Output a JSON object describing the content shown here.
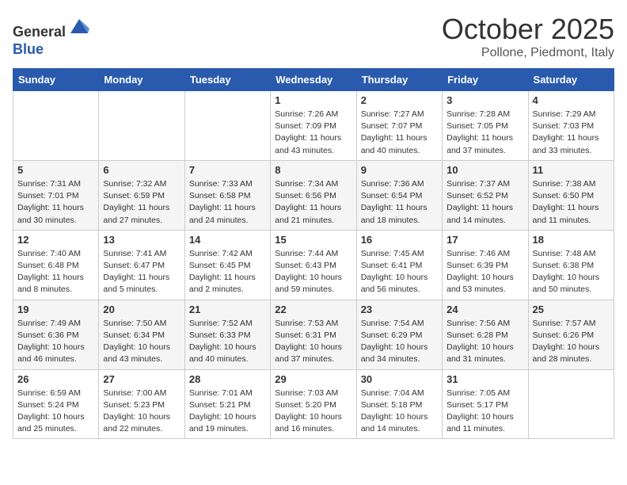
{
  "header": {
    "logo_line1": "General",
    "logo_line2": "Blue",
    "month": "October 2025",
    "location": "Pollone, Piedmont, Italy"
  },
  "days_of_week": [
    "Sunday",
    "Monday",
    "Tuesday",
    "Wednesday",
    "Thursday",
    "Friday",
    "Saturday"
  ],
  "weeks": [
    [
      {
        "day": "",
        "info": ""
      },
      {
        "day": "",
        "info": ""
      },
      {
        "day": "",
        "info": ""
      },
      {
        "day": "1",
        "info": "Sunrise: 7:26 AM\nSunset: 7:09 PM\nDaylight: 11 hours\nand 43 minutes."
      },
      {
        "day": "2",
        "info": "Sunrise: 7:27 AM\nSunset: 7:07 PM\nDaylight: 11 hours\nand 40 minutes."
      },
      {
        "day": "3",
        "info": "Sunrise: 7:28 AM\nSunset: 7:05 PM\nDaylight: 11 hours\nand 37 minutes."
      },
      {
        "day": "4",
        "info": "Sunrise: 7:29 AM\nSunset: 7:03 PM\nDaylight: 11 hours\nand 33 minutes."
      }
    ],
    [
      {
        "day": "5",
        "info": "Sunrise: 7:31 AM\nSunset: 7:01 PM\nDaylight: 11 hours\nand 30 minutes."
      },
      {
        "day": "6",
        "info": "Sunrise: 7:32 AM\nSunset: 6:59 PM\nDaylight: 11 hours\nand 27 minutes."
      },
      {
        "day": "7",
        "info": "Sunrise: 7:33 AM\nSunset: 6:58 PM\nDaylight: 11 hours\nand 24 minutes."
      },
      {
        "day": "8",
        "info": "Sunrise: 7:34 AM\nSunset: 6:56 PM\nDaylight: 11 hours\nand 21 minutes."
      },
      {
        "day": "9",
        "info": "Sunrise: 7:36 AM\nSunset: 6:54 PM\nDaylight: 11 hours\nand 18 minutes."
      },
      {
        "day": "10",
        "info": "Sunrise: 7:37 AM\nSunset: 6:52 PM\nDaylight: 11 hours\nand 14 minutes."
      },
      {
        "day": "11",
        "info": "Sunrise: 7:38 AM\nSunset: 6:50 PM\nDaylight: 11 hours\nand 11 minutes."
      }
    ],
    [
      {
        "day": "12",
        "info": "Sunrise: 7:40 AM\nSunset: 6:48 PM\nDaylight: 11 hours\nand 8 minutes."
      },
      {
        "day": "13",
        "info": "Sunrise: 7:41 AM\nSunset: 6:47 PM\nDaylight: 11 hours\nand 5 minutes."
      },
      {
        "day": "14",
        "info": "Sunrise: 7:42 AM\nSunset: 6:45 PM\nDaylight: 11 hours\nand 2 minutes."
      },
      {
        "day": "15",
        "info": "Sunrise: 7:44 AM\nSunset: 6:43 PM\nDaylight: 10 hours\nand 59 minutes."
      },
      {
        "day": "16",
        "info": "Sunrise: 7:45 AM\nSunset: 6:41 PM\nDaylight: 10 hours\nand 56 minutes."
      },
      {
        "day": "17",
        "info": "Sunrise: 7:46 AM\nSunset: 6:39 PM\nDaylight: 10 hours\nand 53 minutes."
      },
      {
        "day": "18",
        "info": "Sunrise: 7:48 AM\nSunset: 6:38 PM\nDaylight: 10 hours\nand 50 minutes."
      }
    ],
    [
      {
        "day": "19",
        "info": "Sunrise: 7:49 AM\nSunset: 6:36 PM\nDaylight: 10 hours\nand 46 minutes."
      },
      {
        "day": "20",
        "info": "Sunrise: 7:50 AM\nSunset: 6:34 PM\nDaylight: 10 hours\nand 43 minutes."
      },
      {
        "day": "21",
        "info": "Sunrise: 7:52 AM\nSunset: 6:33 PM\nDaylight: 10 hours\nand 40 minutes."
      },
      {
        "day": "22",
        "info": "Sunrise: 7:53 AM\nSunset: 6:31 PM\nDaylight: 10 hours\nand 37 minutes."
      },
      {
        "day": "23",
        "info": "Sunrise: 7:54 AM\nSunset: 6:29 PM\nDaylight: 10 hours\nand 34 minutes."
      },
      {
        "day": "24",
        "info": "Sunrise: 7:56 AM\nSunset: 6:28 PM\nDaylight: 10 hours\nand 31 minutes."
      },
      {
        "day": "25",
        "info": "Sunrise: 7:57 AM\nSunset: 6:26 PM\nDaylight: 10 hours\nand 28 minutes."
      }
    ],
    [
      {
        "day": "26",
        "info": "Sunrise: 6:59 AM\nSunset: 5:24 PM\nDaylight: 10 hours\nand 25 minutes."
      },
      {
        "day": "27",
        "info": "Sunrise: 7:00 AM\nSunset: 5:23 PM\nDaylight: 10 hours\nand 22 minutes."
      },
      {
        "day": "28",
        "info": "Sunrise: 7:01 AM\nSunset: 5:21 PM\nDaylight: 10 hours\nand 19 minutes."
      },
      {
        "day": "29",
        "info": "Sunrise: 7:03 AM\nSunset: 5:20 PM\nDaylight: 10 hours\nand 16 minutes."
      },
      {
        "day": "30",
        "info": "Sunrise: 7:04 AM\nSunset: 5:18 PM\nDaylight: 10 hours\nand 14 minutes."
      },
      {
        "day": "31",
        "info": "Sunrise: 7:05 AM\nSunset: 5:17 PM\nDaylight: 10 hours\nand 11 minutes."
      },
      {
        "day": "",
        "info": ""
      }
    ]
  ]
}
